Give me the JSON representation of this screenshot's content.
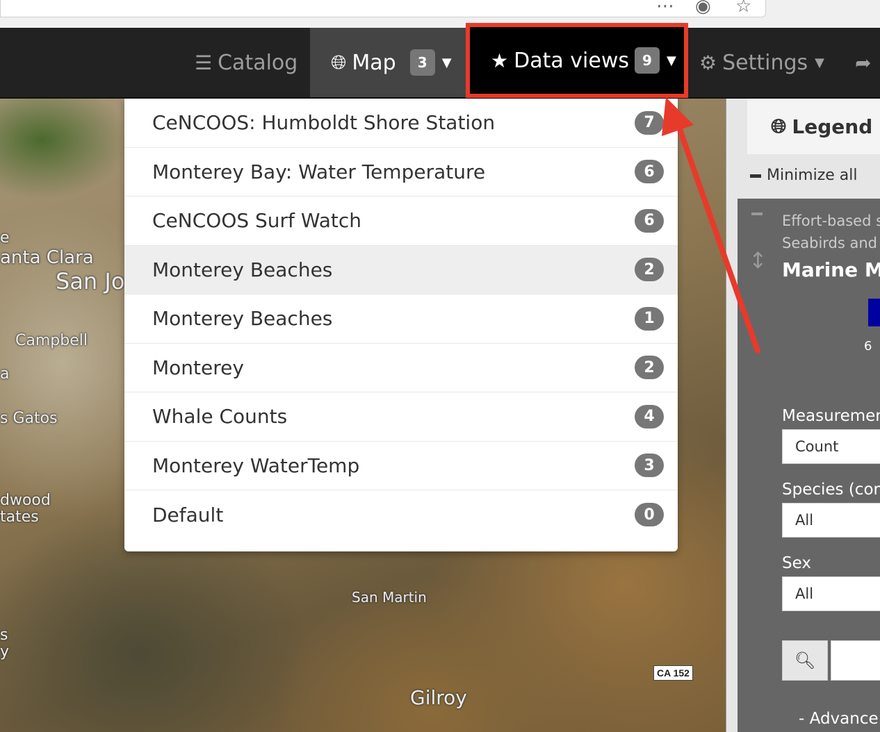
{
  "nav": {
    "catalog_label": "Catalog",
    "catalog_icon": "list-icon",
    "map_label": "Map",
    "map_icon": "globe-icon",
    "map_count": "3",
    "dataviews_label": "Data views",
    "dataviews_icon": "star-icon",
    "dataviews_count": "9",
    "settings_label": "Settings",
    "settings_icon": "gear-icon",
    "share_icon": "share-arrow-icon"
  },
  "dataviews_menu": [
    {
      "label": "CeNCOOS: Humboldt Shore Station",
      "count": "7"
    },
    {
      "label": "Monterey Bay: Water Temperature",
      "count": "6"
    },
    {
      "label": "CeNCOOS Surf Watch",
      "count": "6"
    },
    {
      "label": "Monterey Beaches",
      "count": "2"
    },
    {
      "label": "Monterey Beaches",
      "count": "1"
    },
    {
      "label": "Monterey",
      "count": "2"
    },
    {
      "label": "Whale Counts",
      "count": "4"
    },
    {
      "label": "Monterey WaterTemp",
      "count": "3"
    },
    {
      "label": "Default",
      "count": "0"
    }
  ],
  "map_labels": {
    "santa_clara": "anta Clara",
    "san_jose": "San Jo",
    "campbell": "Campbell",
    "los_gatos": "s Gatos",
    "redwood": "dwood",
    "estates": "tates",
    "san_martin": "San Martin",
    "gilroy": "Gilroy",
    "shield": "CA 152",
    "left_e": "e",
    "left_a": "a",
    "left_s": "s",
    "left_y": "y"
  },
  "legend": {
    "tab_label": "Legend",
    "minimize_all": "Minimize all",
    "layer_subtitle_1": "Effort-based s",
    "layer_subtitle_2": "Seabirds and",
    "layer_title": "Marine Ma",
    "scale_tick": "6",
    "measurement_label": "Measuremen",
    "measurement_value": "Count",
    "species_label": "Species (com",
    "species_value": "All",
    "sex_label": "Sex",
    "sex_value": "All",
    "advanced_label": "Advance"
  },
  "colors": {
    "navbar_bg": "#222222",
    "highlight_border": "#e83a2b",
    "badge": "#777777"
  }
}
